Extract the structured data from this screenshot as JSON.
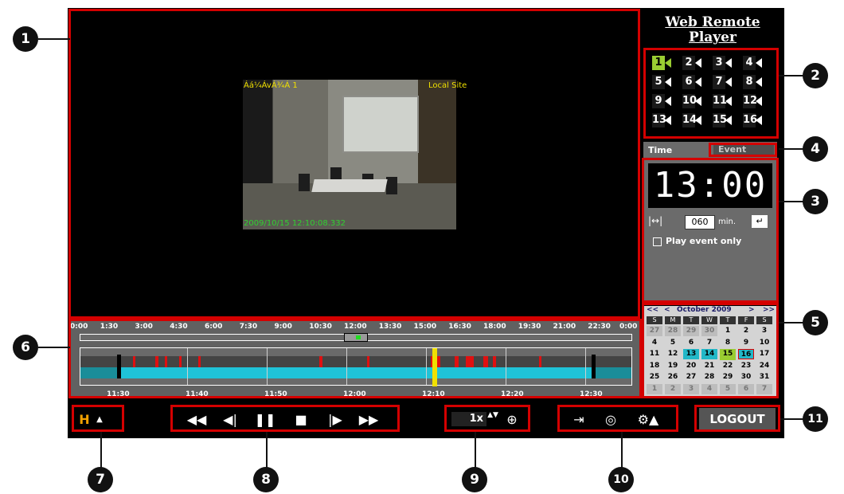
{
  "app": {
    "logo_line1": "Web Remote",
    "logo_line2": "Player"
  },
  "video": {
    "channel_label": "Áá¼ÁvÁ¾Á 1",
    "site_label": "Local Site",
    "timestamp": "2009/10/15 12:10:08.332"
  },
  "cameras": [
    "1",
    "2",
    "3",
    "4",
    "5",
    "6",
    "7",
    "8",
    "9",
    "10",
    "11",
    "12",
    "13",
    "14",
    "15",
    "16"
  ],
  "active_camera": "1",
  "time_panel": {
    "tab_time": "Time",
    "tab_event": "Event",
    "clock": "13:00",
    "range_icon": "|↔|",
    "range_value": "060",
    "range_unit": "min.",
    "enter_icon": "↵",
    "play_event_only": "Play event only"
  },
  "calendar": {
    "nav_prev_year": "<<",
    "nav_prev_month": "<",
    "month_label": "October 2009",
    "nav_next_month": ">",
    "nav_next_year": ">>",
    "weekdays": [
      "S",
      "M",
      "T",
      "W",
      "T",
      "F",
      "S"
    ],
    "weeks": [
      [
        "27",
        "28",
        "29",
        "30",
        "1",
        "2",
        "3"
      ],
      [
        "4",
        "5",
        "6",
        "7",
        "8",
        "9",
        "10"
      ],
      [
        "11",
        "12",
        "13",
        "14",
        "15",
        "16",
        "17"
      ],
      [
        "18",
        "19",
        "20",
        "21",
        "22",
        "23",
        "24"
      ],
      [
        "25",
        "26",
        "27",
        "28",
        "29",
        "30",
        "31"
      ],
      [
        "1",
        "2",
        "3",
        "4",
        "5",
        "6",
        "7"
      ]
    ],
    "recorded_days": [
      "13",
      "14",
      "16"
    ],
    "event_day": "15",
    "selected_day": "16"
  },
  "timeline": {
    "top_ticks": [
      "0:00",
      "1:30",
      "3:00",
      "4:30",
      "6:00",
      "7:30",
      "9:00",
      "10:30",
      "12:00",
      "13:30",
      "15:00",
      "16:30",
      "18:00",
      "19:30",
      "21:00",
      "22:30",
      "0:00"
    ],
    "bottom_ticks": [
      "11:30",
      "11:40",
      "11:50",
      "12:00",
      "12:10",
      "12:20",
      "12:30"
    ]
  },
  "controls": {
    "quality_icon": "H",
    "quality_arrow": "▲",
    "rewind": "◀◀",
    "step_back": "◀|",
    "pause": "❚❚",
    "stop": "■",
    "step_forward": "|▶",
    "fast_forward": "▶▶",
    "speed": "1x",
    "speed_arrows": "▲▼",
    "zoom_icon": "⊕",
    "export_icon": "⇥",
    "snapshot_icon": "◎",
    "settings_icon": "⚙▲",
    "logout": "LOGOUT"
  },
  "callouts": [
    "1",
    "2",
    "3",
    "4",
    "5",
    "6",
    "7",
    "8",
    "9",
    "10",
    "11"
  ]
}
